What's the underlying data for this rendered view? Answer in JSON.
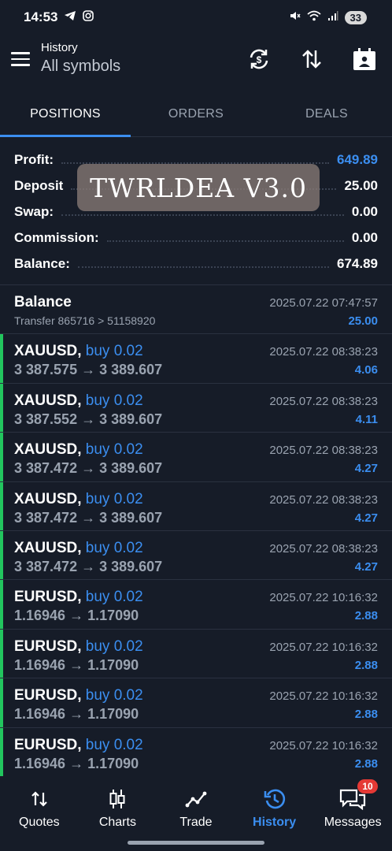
{
  "status": {
    "time": "14:53",
    "battery": "33"
  },
  "header": {
    "subtitle": "History",
    "title": "All symbols"
  },
  "tabs": [
    {
      "label": "POSITIONS",
      "active": true
    },
    {
      "label": "ORDERS",
      "active": false
    },
    {
      "label": "DEALS",
      "active": false
    }
  ],
  "summary": [
    {
      "label": "Profit:",
      "value": "649.89"
    },
    {
      "label": "Deposit",
      "value": "25.00"
    },
    {
      "label": "Swap:",
      "value": "0.00"
    },
    {
      "label": "Commission:",
      "value": "0.00"
    },
    {
      "label": "Balance:",
      "value": "674.89"
    }
  ],
  "watermark": "TWRLDEA V3.0",
  "balance_entry": {
    "title": "Balance",
    "detail": "Transfer 865716 > 51158920",
    "time": "2025.07.22 07:47:57",
    "value": "25.00"
  },
  "positions": [
    {
      "symbol": "XAUUSD,",
      "side": "buy 0.02",
      "prices": "3 387.575 → 3 389.607",
      "time": "2025.07.22 08:38:23",
      "profit": "4.06"
    },
    {
      "symbol": "XAUUSD,",
      "side": "buy 0.02",
      "prices": "3 387.552 → 3 389.607",
      "time": "2025.07.22 08:38:23",
      "profit": "4.11"
    },
    {
      "symbol": "XAUUSD,",
      "side": "buy 0.02",
      "prices": "3 387.472 → 3 389.607",
      "time": "2025.07.22 08:38:23",
      "profit": "4.27"
    },
    {
      "symbol": "XAUUSD,",
      "side": "buy 0.02",
      "prices": "3 387.472 → 3 389.607",
      "time": "2025.07.22 08:38:23",
      "profit": "4.27"
    },
    {
      "symbol": "XAUUSD,",
      "side": "buy 0.02",
      "prices": "3 387.472 → 3 389.607",
      "time": "2025.07.22 08:38:23",
      "profit": "4.27"
    },
    {
      "symbol": "EURUSD,",
      "side": "buy 0.02",
      "prices": "1.16946 → 1.17090",
      "time": "2025.07.22 10:16:32",
      "profit": "2.88"
    },
    {
      "symbol": "EURUSD,",
      "side": "buy 0.02",
      "prices": "1.16946 → 1.17090",
      "time": "2025.07.22 10:16:32",
      "profit": "2.88"
    },
    {
      "symbol": "EURUSD,",
      "side": "buy 0.02",
      "prices": "1.16946 → 1.17090",
      "time": "2025.07.22 10:16:32",
      "profit": "2.88"
    },
    {
      "symbol": "EURUSD,",
      "side": "buy 0.02",
      "prices": "1.16946 → 1.17090",
      "time": "2025.07.22 10:16:32",
      "profit": "2.88"
    }
  ],
  "nav": {
    "quotes": "Quotes",
    "charts": "Charts",
    "trade": "Trade",
    "history": "History",
    "messages": "Messages",
    "messages_badge": "10"
  },
  "colors": {
    "accent": "#3b8ef0",
    "background": "#161c28",
    "buy_bar": "#22c55e",
    "badge": "#e53935"
  }
}
